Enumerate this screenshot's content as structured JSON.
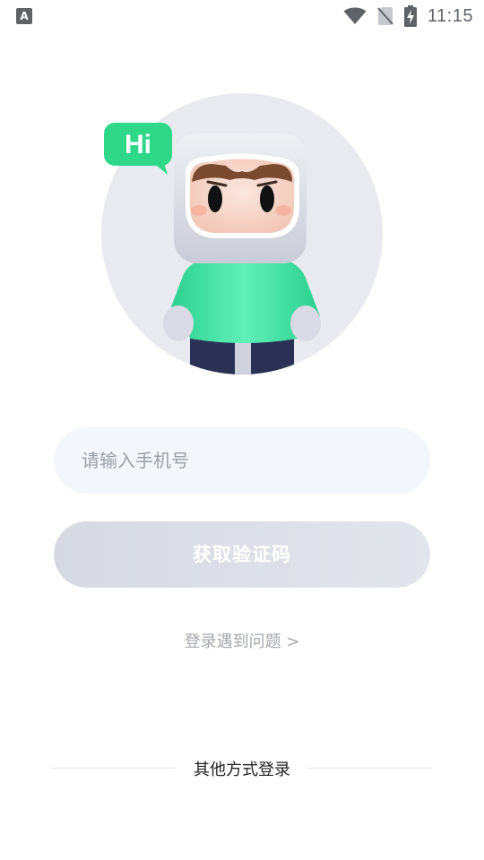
{
  "status_bar": {
    "notification_icon": "a-icon",
    "time": "11:15",
    "icons": [
      "wifi-icon",
      "no-sim-icon",
      "battery-charging-icon"
    ]
  },
  "hero": {
    "bubble_text": "Hi",
    "accent_color": "#2fd889"
  },
  "login": {
    "phone_placeholder": "请输入手机号",
    "phone_value": "",
    "get_code_label": "获取验证码",
    "help_link": "登录遇到问题 >"
  },
  "other_login": {
    "label": "其他方式登录"
  }
}
